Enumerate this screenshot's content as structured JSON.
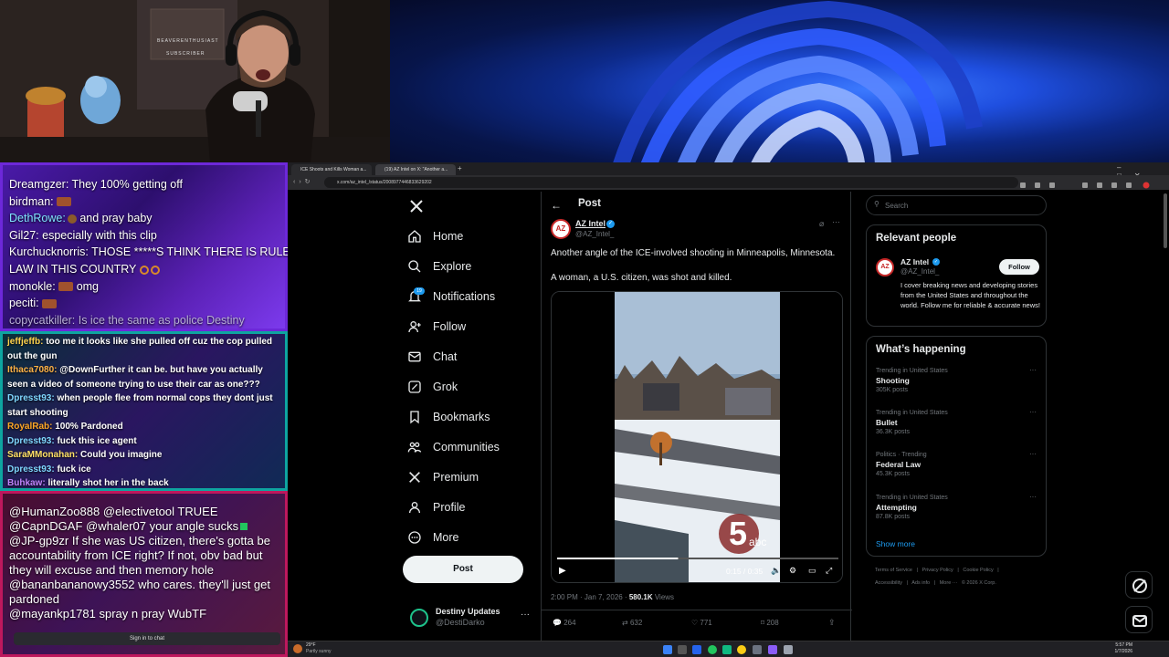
{
  "chat_top": {
    "messages": [
      {
        "user": "Dreamgzer:",
        "text": " They 100% getting off",
        "color": "#ffffff"
      },
      {
        "user": "birdman:",
        "text": " ",
        "color": "#ffffff"
      },
      {
        "user": "DethRowe:",
        "text": " and pray baby",
        "color": "#7fe3ff"
      },
      {
        "user": "Gil27:",
        "text": " especially with this clip",
        "color": "#ffffff"
      },
      {
        "user": "Kurchucknorris:",
        "text": " THOSE *****S THINK THERE IS RULE OF",
        "color": "#ffffff"
      },
      {
        "user": "",
        "text": "LAW IN THIS COUNTRY",
        "color": "#ffffff"
      },
      {
        "user": "monokle:",
        "text": " omg",
        "color": "#ffffff"
      },
      {
        "user": "peciti:",
        "text": "",
        "color": "#ffffff"
      },
      {
        "user": "copycatkiller:",
        "text": " Is ice the same as police Destiny",
        "color": "#b9b0d9"
      }
    ]
  },
  "chat_mid": {
    "messages": [
      {
        "user": "jeffjeffb:",
        "text": " too me it looks like she pulled off cuz the cop pulled out the gun",
        "color": "#ffd34d"
      },
      {
        "user": "Ithaca7080:",
        "text": " @DownFurther it can be. but have you actually seen a video of someone trying to use their car as one???",
        "color": "#ffb347"
      },
      {
        "user": "Dpresst93:",
        "text": " when people flee from normal cops they dont just start shooting",
        "color": "#7fd7ff"
      },
      {
        "user": "RoyalRab:",
        "text": " 100% Pardoned",
        "color": "#ffa726"
      },
      {
        "user": "Dpresst93:",
        "text": " fuck this ice agent",
        "color": "#7fd7ff"
      },
      {
        "user": "SaraMMonahan:",
        "text": " Could you imagine",
        "color": "#ffe066"
      },
      {
        "user": "Dpresst93:",
        "text": " fuck ice",
        "color": "#7fd7ff"
      },
      {
        "user": "Buhkaw:",
        "text": " literally shot her in the back",
        "color": "#c084fc"
      }
    ]
  },
  "chat_bottom": {
    "messages": [
      {
        "user": "@HumanZoo888",
        "text": " @electivetool TRUEE"
      },
      {
        "user": "@CapnDGAF",
        "text": " @whaler07 your angle sucks"
      },
      {
        "user": "@JP-gp9zr",
        "text": " If she was US citizen, there's gotta be accountability from ICE right? If not, obv bad but they will excuse and then memory hole"
      },
      {
        "user": "@bananbananowy3552",
        "text": " who cares. they'll just get pardoned"
      },
      {
        "user": "@mayankp1781",
        "text": " spray n pray WubTF"
      }
    ],
    "sign_in": "Sign in to chat"
  },
  "browser": {
    "tabs": [
      "ICE Shoots and Kills Woman a...",
      "(19) AZ Intel on X: \"Another a..."
    ],
    "url": "x.com/az_intel_/status/2008977446833629202"
  },
  "nav": {
    "items": [
      "Home",
      "Explore",
      "Notifications",
      "Follow",
      "Chat",
      "Grok",
      "Bookmarks",
      "Communities",
      "Premium",
      "Profile",
      "More"
    ],
    "notif_badge": "19",
    "post_button": "Post",
    "account_name": "Destiny Updates",
    "account_handle": "@DestiDarko"
  },
  "post": {
    "header": "Post",
    "author": "AZ Intel",
    "handle": "@AZ_Intel_",
    "text1": "Another angle of the ICE-involved shooting in Minneapolis, Minnesota.",
    "text2": "A woman, a U.S. citizen, was shot and killed.",
    "video_time": "0:15 / 0:35",
    "video_progress": 0.43,
    "timestamp": "2:00 PM · Jan 7, 2026 · ",
    "views_count": "580.1K",
    "views_label": " Views",
    "replies": "264",
    "reposts": "632",
    "likes": "771",
    "bookmarks": "208"
  },
  "right": {
    "search_placeholder": "Search",
    "relevant_title": "Relevant people",
    "person_name": "AZ Intel",
    "person_handle": "@AZ_Intel_",
    "person_bio": "I cover breaking news and developing stories from the United States and throughout the world. Follow me for reliable & accurate news!",
    "follow_label": "Follow",
    "happening_title": "What’s happening",
    "trends": [
      {
        "context": "Trending in United States",
        "title": "Shooting",
        "posts": "305K posts"
      },
      {
        "context": "Trending in United States",
        "title": "Bullet",
        "posts": "36.3K posts"
      },
      {
        "context": "Politics · Trending",
        "title": "Federal Law",
        "posts": "45.3K posts"
      },
      {
        "context": "Trending in United States",
        "title": "Attempting",
        "posts": "87.8K posts"
      }
    ],
    "show_more": "Show more",
    "footer1": "Terms of Service   |   Privacy Policy   |   Cookie Policy   |",
    "footer2": "Accessibility   |   Ads info   |   More ···   © 2026 X Corp."
  },
  "webcam": {
    "poster_line1": "BEAVERENTHUSIAST",
    "poster_line2": "SUBSCRIBER"
  },
  "taskbar": {
    "weather_temp": "29°F",
    "weather_desc": "Partly sunny",
    "time": "5:57 PM",
    "date": "1/7/2026"
  }
}
